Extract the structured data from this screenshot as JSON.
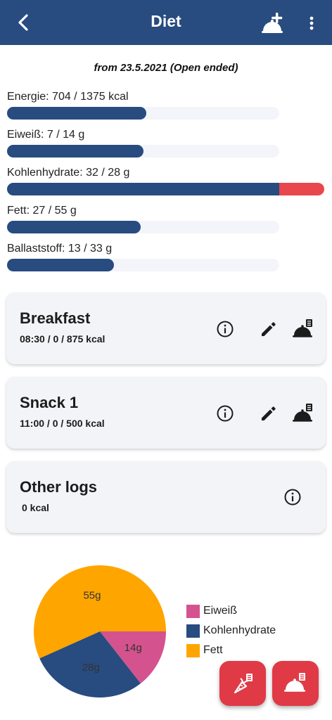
{
  "header": {
    "title": "Diet",
    "back_icon": "arrow-back-icon",
    "add_icon": "cloche-plus-icon",
    "more_icon": "more-vert-icon"
  },
  "plan": {
    "date_range": "from 23.5.2021 (Open ended)"
  },
  "nutrients": [
    {
      "label": "Energie: 704 / 1375 kcal",
      "consumed": 704,
      "goal": 1375,
      "unit": "kcal"
    },
    {
      "label": "Eiweiß: 7 / 14 g",
      "consumed": 7,
      "goal": 14,
      "unit": "g"
    },
    {
      "label": "Kohlenhydrate: 32 / 28 g",
      "consumed": 32,
      "goal": 28,
      "unit": "g"
    },
    {
      "label": "Fett: 27 / 55 g",
      "consumed": 27,
      "goal": 55,
      "unit": "g"
    },
    {
      "label": "Ballaststoff: 13 / 33 g",
      "consumed": 13,
      "goal": 33,
      "unit": "g"
    }
  ],
  "meals": [
    {
      "name": "Breakfast",
      "summary": "08:30 /  0 / 875 kcal",
      "icons": [
        "info-icon",
        "edit-icon",
        "log-meal-icon"
      ]
    },
    {
      "name": "Snack 1",
      "summary": "11:00 /  0 / 500 kcal",
      "icons": [
        "info-icon",
        "edit-icon",
        "log-meal-icon"
      ]
    },
    {
      "name": "Other logs",
      "summary": "0 kcal",
      "icons": [
        "info-icon"
      ]
    }
  ],
  "chart_data": {
    "type": "pie",
    "slices": [
      {
        "name": "Eiweiß",
        "value": 14,
        "label": "14g",
        "color": "#d4538f"
      },
      {
        "name": "Kohlenhydrate",
        "value": 28,
        "label": "28g",
        "color": "#284b80"
      },
      {
        "name": "Fett",
        "value": 55,
        "label": "55g",
        "color": "#ffa500"
      }
    ],
    "legend": [
      "Eiweiß",
      "Kohlenhydrate",
      "Fett"
    ],
    "legend_position": "right"
  },
  "fabs": [
    {
      "icon": "food-log-icon"
    },
    {
      "icon": "meal-log-icon"
    }
  ],
  "colors": {
    "primary": "#284b80",
    "over_goal": "#e8474c",
    "track": "#f4f5fa",
    "fab": "#e03a46"
  }
}
